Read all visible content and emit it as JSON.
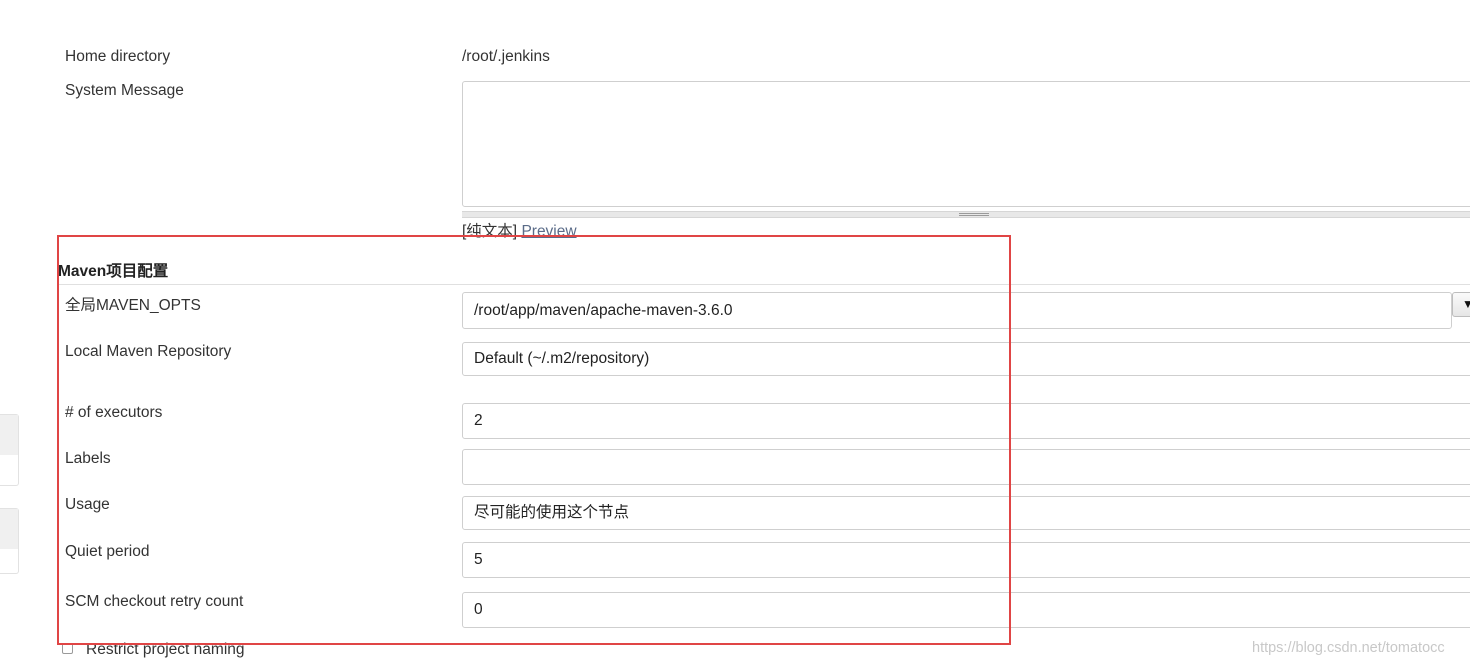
{
  "fields": {
    "home_directory": {
      "label": "Home directory",
      "value": "/root/.jenkins"
    },
    "system_message": {
      "label": "System Message",
      "value": ""
    },
    "markup": {
      "plain_text": "[纯文本]",
      "preview": "Preview"
    }
  },
  "maven_section": {
    "title": "Maven项目配置",
    "global_maven_opts": {
      "label": "全局MAVEN_OPTS",
      "value": "/root/app/maven/apache-maven-3.6.0"
    },
    "local_repository": {
      "label": "Local Maven Repository",
      "selected": "Default (~/.m2/repository)"
    },
    "executors": {
      "label": "# of executors",
      "value": "2"
    },
    "labels": {
      "label": "Labels",
      "value": ""
    },
    "usage": {
      "label": "Usage",
      "selected": "尽可能的使用这个节点"
    },
    "quiet_period": {
      "label": "Quiet period",
      "value": "5"
    },
    "scm_retry": {
      "label": "SCM checkout retry count",
      "value": "0"
    }
  },
  "restrict_naming": {
    "label": "Restrict project naming",
    "checked": false
  },
  "icons": {
    "dropdown": "▼",
    "dropdown_name": "dropdown-arrow-icon"
  },
  "watermark": "https://blog.csdn.net/tomatocc",
  "colors": {
    "highlight_box": "#e04545",
    "link": "#5a6b88"
  }
}
